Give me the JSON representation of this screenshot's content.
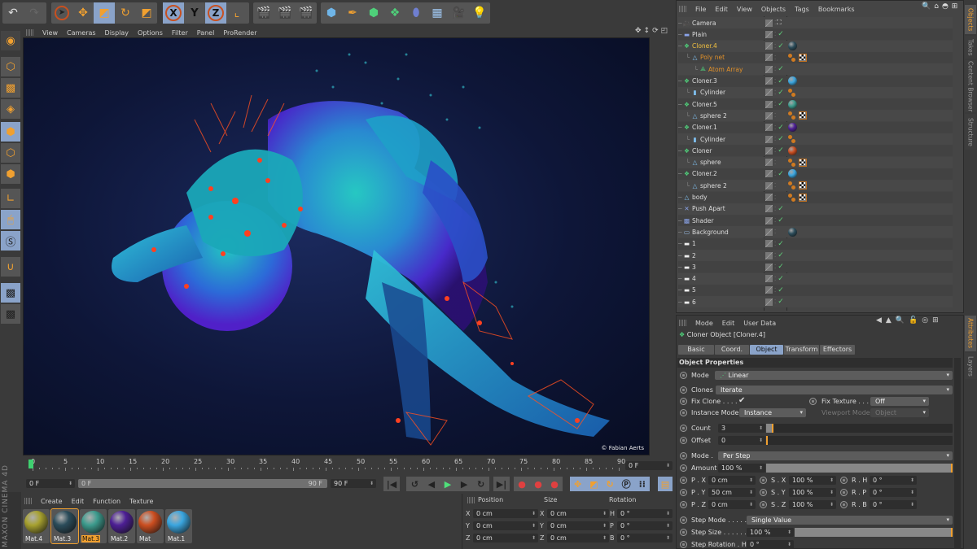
{
  "toolbar": {
    "tools": [
      "undo-icon",
      "redo-icon",
      "live-selection-icon",
      "move-icon",
      "scale-icon",
      "rotate-icon",
      "last-tool-icon",
      "x-axis-icon",
      "y-axis-icon",
      "z-axis-icon",
      "coordinate-system-icon",
      "render-view-icon",
      "render-picture-viewer-icon",
      "render-settings-icon",
      "cube-icon",
      "pen-spline-icon",
      "subdivision-surface-icon",
      "cloner-icon",
      "deformer-icon",
      "floor-icon",
      "camera-icon",
      "light-icon"
    ],
    "axis_labels": {
      "x": "X",
      "y": "Y",
      "z": "Z"
    }
  },
  "left_tools": [
    "make-editable-icon",
    "model-mode-icon",
    "texture-mode-icon",
    "workplane-mode-icon",
    "points-mode-icon",
    "edges-mode-icon",
    "polygons-mode-icon",
    "axis-mode-icon",
    "tweak-mode-icon",
    "solo-icon",
    "snapping-icon",
    "locked-workplane-icon",
    "planar-workplane-icon"
  ],
  "viewport": {
    "menu": [
      "View",
      "Cameras",
      "Display",
      "Options",
      "Filter",
      "Panel",
      "ProRender"
    ],
    "credit": "© Fabian Aerts"
  },
  "timeline": {
    "ticks": [
      "0",
      "5",
      "10",
      "15",
      "20",
      "25",
      "30",
      "35",
      "40",
      "45",
      "50",
      "55",
      "60",
      "65",
      "70",
      "75",
      "80",
      "85",
      "90"
    ],
    "current_frame": "0 F",
    "start_field": "0 F",
    "range_start": "0 F",
    "range_end": "90 F",
    "end_field": "90 F",
    "playback_buttons": [
      "go-to-start",
      "previous-key",
      "previous-frame",
      "play",
      "next-frame",
      "next-key",
      "go-to-end"
    ],
    "record_buttons": [
      "record-active",
      "autokey",
      "keyframe-selection"
    ],
    "key_buttons": [
      "position-key",
      "scale-key",
      "rotation-key",
      "parameter-key",
      "point-level-animation",
      "timeline-window"
    ]
  },
  "materials": {
    "menu": [
      "Create",
      "Edit",
      "Function",
      "Texture"
    ],
    "items": [
      {
        "name": "Mat.4",
        "color": "#a7a12f"
      },
      {
        "name": "Mat.3",
        "color": "#2b4c5a"
      },
      {
        "name": "Mat.3",
        "color": "#3c9b8d",
        "selected": true
      },
      {
        "name": "Mat.2",
        "color": "#4d1f95"
      },
      {
        "name": "Mat",
        "color": "#cc4e20"
      },
      {
        "name": "Mat.1",
        "color": "#3aa6e0"
      }
    ],
    "brand": "MAXON CINEMA 4D"
  },
  "coordinates": {
    "headers": [
      "Position",
      "Size",
      "Rotation"
    ],
    "rows": [
      {
        "pos_label": "X",
        "pos": "0 cm",
        "size_label": "X",
        "size": "0 cm",
        "rot_label": "H",
        "rot": "0 °"
      },
      {
        "pos_label": "Y",
        "pos": "0 cm",
        "size_label": "Y",
        "size": "0 cm",
        "rot_label": "P",
        "rot": "0 °"
      },
      {
        "pos_label": "Z",
        "pos": "0 cm",
        "size_label": "Z",
        "size": "0 cm",
        "rot_label": "B",
        "rot": "0 °"
      }
    ]
  },
  "object_manager": {
    "menu": [
      "File",
      "Edit",
      "View",
      "Objects",
      "Tags",
      "Bookmarks"
    ],
    "objects": [
      {
        "name": "Camera",
        "icon": "camera-icon",
        "indent": 0,
        "check": false,
        "tags": [
          "target"
        ]
      },
      {
        "name": "Plain",
        "icon": "plain-icon",
        "indent": 0,
        "check": true,
        "tags": []
      },
      {
        "name": "Cloner.4",
        "icon": "cloner-icon",
        "indent": 0,
        "check": true,
        "highlight": "#f0c040",
        "tags": [
          "ball:#2b4c5a"
        ]
      },
      {
        "name": "Poly net",
        "icon": "polygon-icon",
        "indent": 1,
        "check": false,
        "highlight": "#e0902a",
        "tags": [
          "dots",
          "checker"
        ]
      },
      {
        "name": "Atom Array",
        "icon": "atom-array-icon",
        "indent": 2,
        "check": true,
        "highlight": "#e0902a",
        "tags": []
      },
      {
        "name": "Cloner.3",
        "icon": "cloner-icon",
        "indent": 0,
        "check": true,
        "tags": [
          "ball:#3aa6e0"
        ]
      },
      {
        "name": "Cylinder",
        "icon": "cylinder-icon",
        "indent": 1,
        "check": true,
        "tags": [
          "dots"
        ]
      },
      {
        "name": "Cloner.5",
        "icon": "cloner-icon",
        "indent": 0,
        "check": true,
        "tags": [
          "ball:#3c9b8d"
        ]
      },
      {
        "name": "sphere 2",
        "icon": "polygon-icon",
        "indent": 1,
        "check": false,
        "tags": [
          "dots",
          "checker"
        ]
      },
      {
        "name": "Cloner.1",
        "icon": "cloner-icon",
        "indent": 0,
        "check": true,
        "tags": [
          "ball:#4d1f95"
        ]
      },
      {
        "name": "Cylinder",
        "icon": "cylinder-icon",
        "indent": 1,
        "check": true,
        "tags": [
          "dots"
        ]
      },
      {
        "name": "Cloner",
        "icon": "cloner-icon",
        "indent": 0,
        "check": true,
        "tags": [
          "ball:#cc4e20"
        ]
      },
      {
        "name": "sphere",
        "icon": "polygon-icon",
        "indent": 1,
        "check": false,
        "tags": [
          "dots",
          "checker"
        ]
      },
      {
        "name": "Cloner.2",
        "icon": "cloner-icon",
        "indent": 0,
        "check": true,
        "tags": [
          "ball:#3aa6e0"
        ]
      },
      {
        "name": "sphere 2",
        "icon": "polygon-icon",
        "indent": 1,
        "check": false,
        "tags": [
          "dots",
          "checker"
        ]
      },
      {
        "name": "body",
        "icon": "polygon-icon",
        "indent": 0,
        "check": false,
        "tags": [
          "dots",
          "checker"
        ]
      },
      {
        "name": "Push Apart",
        "icon": "push-apart-icon",
        "indent": 0,
        "check": true,
        "tags": []
      },
      {
        "name": "Shader",
        "icon": "shader-effector-icon",
        "indent": 0,
        "check": true,
        "tags": []
      },
      {
        "name": "Background",
        "icon": "background-icon",
        "indent": 0,
        "check": false,
        "tags": [
          "ball:#2b4c5a"
        ]
      },
      {
        "name": "1",
        "icon": "plane-icon",
        "indent": 0,
        "check": true,
        "tags": []
      },
      {
        "name": "2",
        "icon": "plane-icon",
        "indent": 0,
        "check": true,
        "tags": []
      },
      {
        "name": "3",
        "icon": "plane-icon",
        "indent": 0,
        "check": true,
        "tags": []
      },
      {
        "name": "4",
        "icon": "plane-icon",
        "indent": 0,
        "check": true,
        "tags": []
      },
      {
        "name": "5",
        "icon": "plane-icon",
        "indent": 0,
        "check": true,
        "tags": []
      },
      {
        "name": "6",
        "icon": "plane-icon",
        "indent": 0,
        "check": true,
        "tags": []
      }
    ]
  },
  "side_tabs_top": [
    {
      "label": "Objects",
      "selected": true
    },
    {
      "label": "Takes"
    },
    {
      "label": "Content Browser"
    },
    {
      "label": "Structure"
    }
  ],
  "side_tabs_bottom": [
    {
      "label": "Attributes",
      "selected": true
    },
    {
      "label": "Layers"
    }
  ],
  "attributes": {
    "menu": [
      "Mode",
      "Edit",
      "User Data"
    ],
    "title": "Cloner Object [Cloner.4]",
    "tabs": [
      {
        "label": "Basic"
      },
      {
        "label": "Coord."
      },
      {
        "label": "Object",
        "selected": true
      },
      {
        "label": "Transform"
      },
      {
        "label": "Effectors"
      }
    ],
    "section": "Object Properties",
    "mode_label": "Mode",
    "mode_value": "Linear",
    "clones_label": "Clones",
    "clones_value": "Iterate",
    "fix_clone_label": "Fix Clone . . . .",
    "fix_clone_checked": "✔",
    "fix_texture_label": "Fix Texture . . . .",
    "fix_texture_value": "Off",
    "instance_mode_label": "Instance Mode",
    "instance_mode_value": "Instance",
    "viewport_mode_label": "Viewport Mode",
    "viewport_mode_value": "Object",
    "count_label": "Count",
    "count_value": "3",
    "offset_label": "Offset",
    "offset_value": "0",
    "mode2_label": "Mode .",
    "mode2_value": "Per Step",
    "amount_label": "Amount",
    "amount_value": "100 %",
    "amount_fraction": 1.0,
    "transform": [
      {
        "p_label": "P . X",
        "p": "0 cm",
        "s_label": "S . X",
        "s": "100 %",
        "r_label": "R . H",
        "r": "0 °"
      },
      {
        "p_label": "P . Y",
        "p": "50 cm",
        "s_label": "S . Y",
        "s": "100 %",
        "r_label": "R . P",
        "r": "0 °"
      },
      {
        "p_label": "P . Z",
        "p": "0 cm",
        "s_label": "S . Z",
        "s": "100 %",
        "r_label": "R . B",
        "r": "0 °"
      }
    ],
    "step_mode_label": "Step Mode . . . . .",
    "step_mode_value": "Single Value",
    "step_size_label": "Step Size . . . . . .",
    "step_size_value": "100 %",
    "step_size_fraction": 1.0,
    "step_rotation_label": "Step Rotation . H",
    "step_rotation_value": "0 °"
  }
}
